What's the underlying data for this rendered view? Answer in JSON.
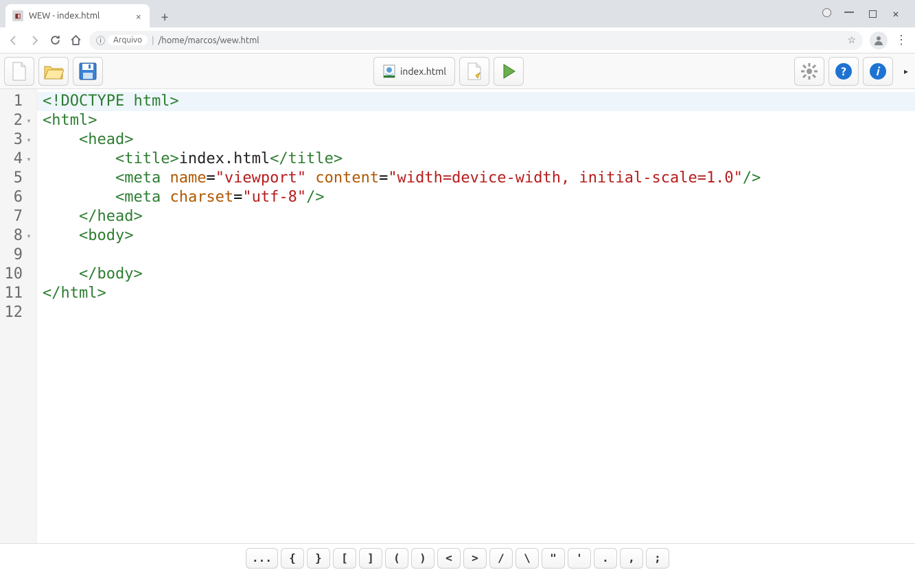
{
  "browser": {
    "tab_title": "WEW - index.html",
    "addr_prefix_label": "Arquivo",
    "addr_path": "/home/marcos/wew.html"
  },
  "app": {
    "filetab_label": "index.html"
  },
  "code": {
    "lines": [
      {
        "n": "1",
        "fold": "",
        "html": "<span class='tag'>&lt;!DOCTYPE html&gt;</span>"
      },
      {
        "n": "2",
        "fold": "▾",
        "html": "<span class='tag'>&lt;html&gt;</span>"
      },
      {
        "n": "3",
        "fold": "▾",
        "html": "    <span class='tag'>&lt;head&gt;</span>"
      },
      {
        "n": "4",
        "fold": "▾",
        "html": "        <span class='tag'>&lt;title&gt;</span><span class='txt'>index.html</span><span class='tag'>&lt;/title&gt;</span>"
      },
      {
        "n": "5",
        "fold": "",
        "html": "        <span class='tag'>&lt;meta</span> <span class='attrname'>name</span>=<span class='attrval'>\"viewport\"</span> <span class='attrname'>content</span>=<span class='attrval'>\"width=device-width, initial-scale=1.0\"</span><span class='tag'>/&gt;</span>"
      },
      {
        "n": "6",
        "fold": "",
        "html": "        <span class='tag'>&lt;meta</span> <span class='attrname'>charset</span>=<span class='attrval'>\"utf-8\"</span><span class='tag'>/&gt;</span>"
      },
      {
        "n": "7",
        "fold": "",
        "html": "    <span class='tag'>&lt;/head&gt;</span>"
      },
      {
        "n": "8",
        "fold": "▾",
        "html": "    <span class='tag'>&lt;body&gt;</span>"
      },
      {
        "n": "9",
        "fold": "",
        "html": ""
      },
      {
        "n": "10",
        "fold": "",
        "html": "    <span class='tag'>&lt;/body&gt;</span>"
      },
      {
        "n": "11",
        "fold": "",
        "html": "<span class='tag'>&lt;/html&gt;</span>"
      },
      {
        "n": "12",
        "fold": "",
        "html": ""
      }
    ],
    "current_line_index": 0
  },
  "symbols": [
    "...",
    "{",
    "}",
    "[",
    "]",
    "(",
    ")",
    "<",
    ">",
    "/",
    "\\",
    "\"",
    "'",
    ".",
    ",",
    ";"
  ]
}
